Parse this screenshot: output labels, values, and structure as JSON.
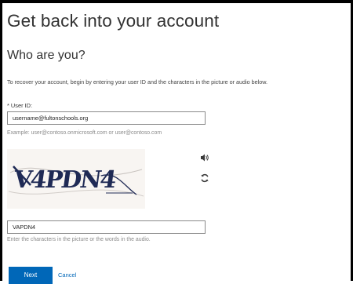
{
  "title": "Get back into your account",
  "subtitle": "Who are you?",
  "intro": "To recover your account, begin by entering your user ID and the characters in the picture or audio below.",
  "user_id": {
    "label": "* User ID:",
    "value": "username@fultonschools.org",
    "hint": "Example: user@contoso.onmicrosoft.com or user@contoso.com"
  },
  "captcha": {
    "image_text": "V4PDN4",
    "input_value": "VAPDN4",
    "hint": "Enter the characters in the picture or the words in the audio.",
    "audio_icon": "speaker-icon",
    "refresh_icon": "refresh-icon"
  },
  "buttons": {
    "next": "Next",
    "cancel": "Cancel"
  },
  "colors": {
    "accent": "#0067b8",
    "title": "#333333",
    "hint": "#8a8a8a"
  }
}
